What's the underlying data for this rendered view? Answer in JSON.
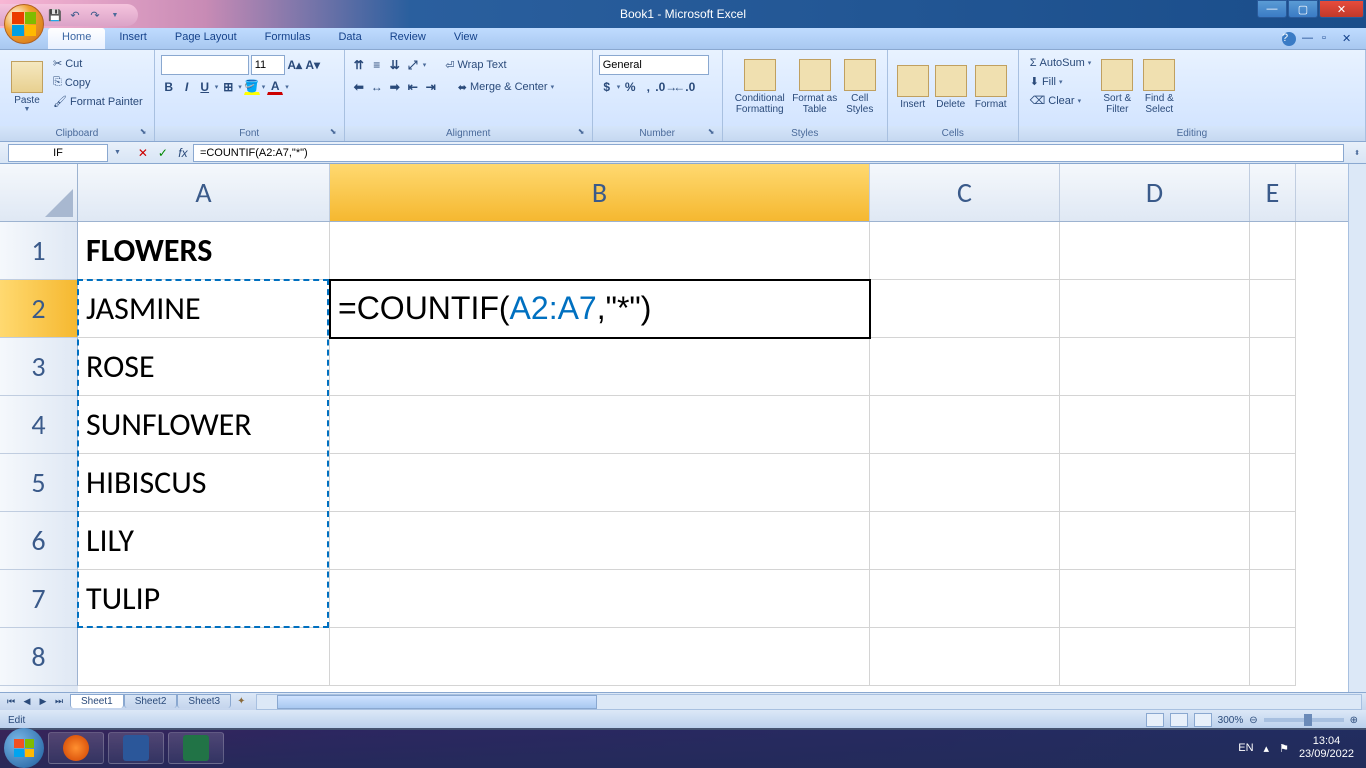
{
  "titlebar": {
    "title": "Book1 - Microsoft Excel"
  },
  "tabs": [
    "Home",
    "Insert",
    "Page Layout",
    "Formulas",
    "Data",
    "Review",
    "View"
  ],
  "ribbon": {
    "clipboard": {
      "label": "Clipboard",
      "paste": "Paste",
      "cut": "Cut",
      "copy": "Copy",
      "painter": "Format Painter"
    },
    "font": {
      "label": "Font",
      "name": "",
      "size": "11"
    },
    "alignment": {
      "label": "Alignment",
      "wrap": "Wrap Text",
      "merge": "Merge & Center"
    },
    "number": {
      "label": "Number",
      "format": "General"
    },
    "styles": {
      "label": "Styles",
      "cond": "Conditional Formatting",
      "table": "Format as Table",
      "cell": "Cell Styles"
    },
    "cells": {
      "label": "Cells",
      "insert": "Insert",
      "delete": "Delete",
      "format": "Format"
    },
    "editing": {
      "label": "Editing",
      "autosum": "AutoSum",
      "fill": "Fill",
      "clear": "Clear",
      "sort": "Sort & Filter",
      "find": "Find & Select"
    }
  },
  "formula_bar": {
    "name_box": "IF",
    "formula": "=COUNTIF(A2:A7,\"*\")"
  },
  "columns": [
    "A",
    "B",
    "C",
    "D",
    "E"
  ],
  "rows": [
    "1",
    "2",
    "3",
    "4",
    "5",
    "6",
    "7",
    "8"
  ],
  "data": {
    "A1": "FLOWERS",
    "A2": "JASMINE",
    "A3": "ROSE",
    "A4": "SUNFLOWER",
    "A5": "HIBISCUS",
    "A6": "LILY",
    "A7": "TULIP",
    "B2_prefix": "=COUNTIF(",
    "B2_ref": "A2:A7",
    "B2_suffix": ",\"*\")"
  },
  "sheets": [
    "Sheet1",
    "Sheet2",
    "Sheet3"
  ],
  "status": {
    "mode": "Edit",
    "zoom": "300%"
  },
  "tray": {
    "lang": "EN",
    "time": "13:04",
    "date": "23/09/2022"
  }
}
